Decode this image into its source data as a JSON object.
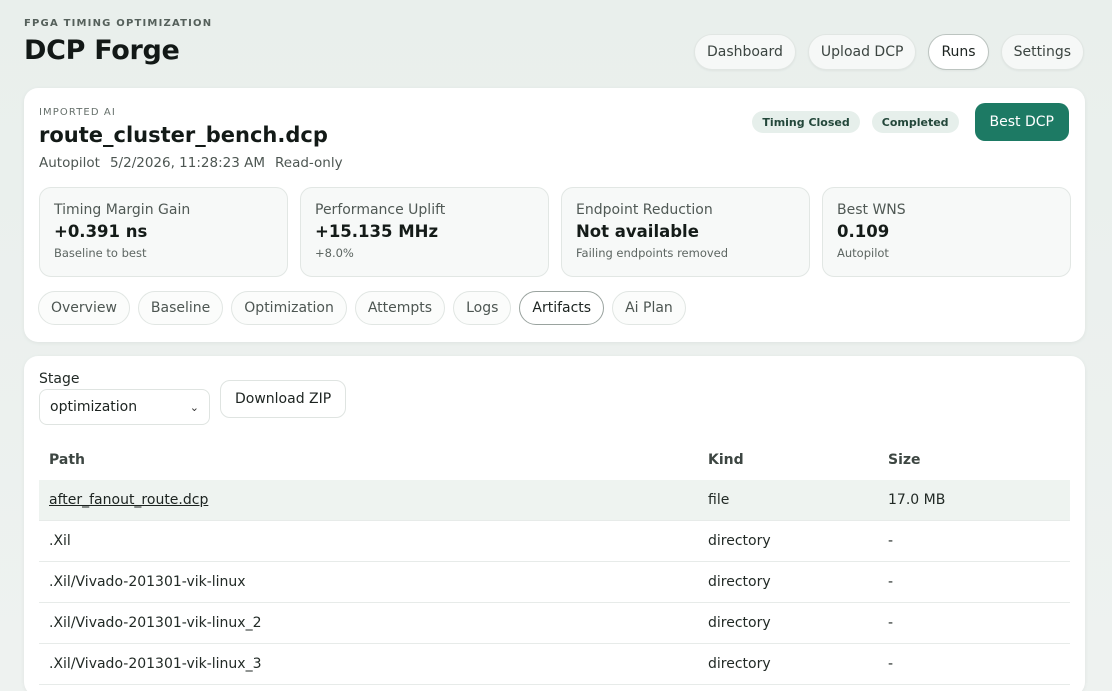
{
  "app": {
    "eyebrow": "FPGA TIMING OPTIMIZATION",
    "title": "DCP Forge"
  },
  "nav": [
    {
      "label": "Dashboard",
      "active": false
    },
    {
      "label": "Upload DCP",
      "active": false
    },
    {
      "label": "Runs",
      "active": true
    },
    {
      "label": "Settings",
      "active": false
    }
  ],
  "run": {
    "kicker": "IMPORTED AI",
    "title": "route_cluster_bench.dcp",
    "mode": "Autopilot",
    "timestamp": "5/2/2026, 11:28:23 AM",
    "access": "Read-only",
    "badges": [
      "Timing Closed",
      "Completed"
    ],
    "best_button": "Best DCP"
  },
  "metrics": [
    {
      "label": "Timing Margin Gain",
      "value": "+0.391 ns",
      "sub": "Baseline to best"
    },
    {
      "label": "Performance Uplift",
      "value": "+15.135 MHz",
      "sub": "+8.0%"
    },
    {
      "label": "Endpoint Reduction",
      "value": "Not available",
      "sub": "Failing endpoints removed"
    },
    {
      "label": "Best WNS",
      "value": "0.109",
      "sub": "Autopilot"
    }
  ],
  "tabs": [
    {
      "label": "Overview",
      "active": false
    },
    {
      "label": "Baseline",
      "active": false
    },
    {
      "label": "Optimization",
      "active": false
    },
    {
      "label": "Attempts",
      "active": false
    },
    {
      "label": "Logs",
      "active": false
    },
    {
      "label": "Artifacts",
      "active": true
    },
    {
      "label": "Ai Plan",
      "active": false
    }
  ],
  "artifacts": {
    "stage_label": "Stage",
    "stage_value": "optimization",
    "download_label": "Download ZIP",
    "columns": {
      "path": "Path",
      "kind": "Kind",
      "size": "Size"
    },
    "rows": [
      {
        "path": "after_fanout_route.dcp",
        "kind": "file",
        "size": "17.0 MB"
      },
      {
        "path": ".Xil",
        "kind": "directory",
        "size": "-"
      },
      {
        "path": ".Xil/Vivado-201301-vik-linux",
        "kind": "directory",
        "size": "-"
      },
      {
        "path": ".Xil/Vivado-201301-vik-linux_2",
        "kind": "directory",
        "size": "-"
      },
      {
        "path": ".Xil/Vivado-201301-vik-linux_3",
        "kind": "directory",
        "size": "-"
      }
    ]
  }
}
